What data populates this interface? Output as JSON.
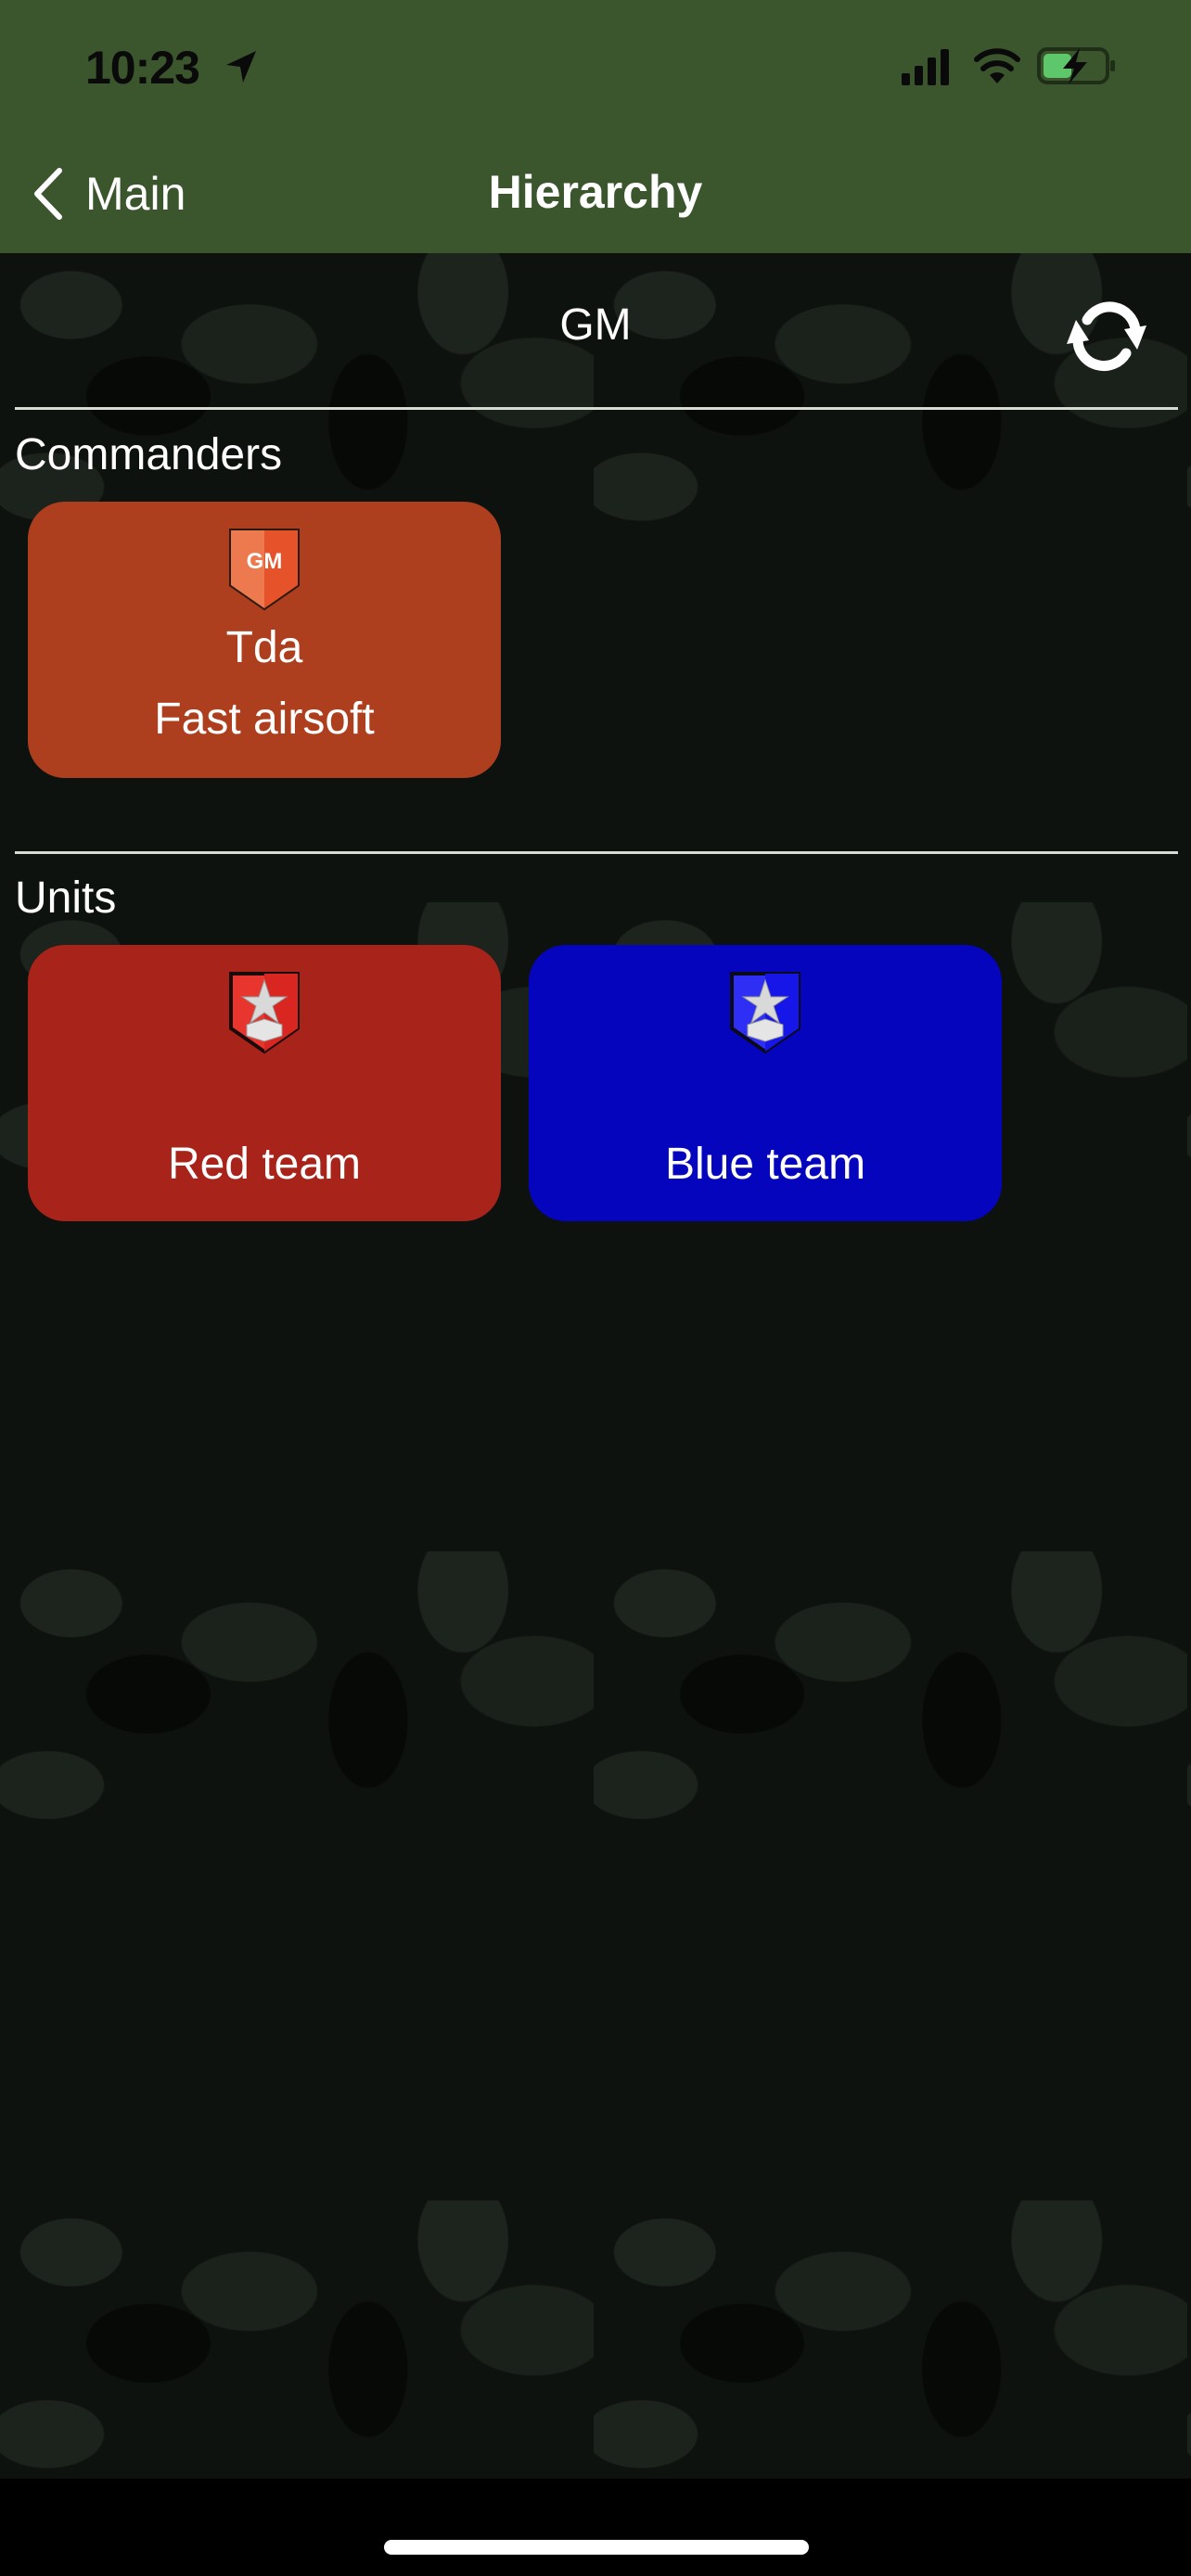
{
  "status_bar": {
    "time": "10:23",
    "icons": [
      "location-arrow-icon",
      "cellular-signal-icon",
      "wifi-icon",
      "battery-charging-icon"
    ]
  },
  "nav": {
    "back_label": "Main",
    "title": "Hierarchy"
  },
  "header": {
    "role": "GM",
    "refresh_icon": "refresh-icon"
  },
  "sections": {
    "commanders": {
      "label": "Commanders",
      "items": [
        {
          "badge_text": "GM",
          "name": "Tda",
          "team": "Fast airsoft",
          "color": "#ae3f1e",
          "badge_color": "#e8603a"
        }
      ]
    },
    "units": {
      "label": "Units",
      "items": [
        {
          "name": "Red team",
          "color": "#a8231a",
          "badge_color": "#e8352d",
          "badge_icon": "star-chevron-badge-icon"
        },
        {
          "name": "Blue team",
          "color": "#0505bd",
          "badge_color": "#2e2ef5",
          "badge_icon": "star-chevron-badge-icon"
        }
      ]
    }
  },
  "colors": {
    "nav_bg": "#3b552c",
    "content_bg": "#0e120e",
    "divider": "#d6dbd3"
  }
}
